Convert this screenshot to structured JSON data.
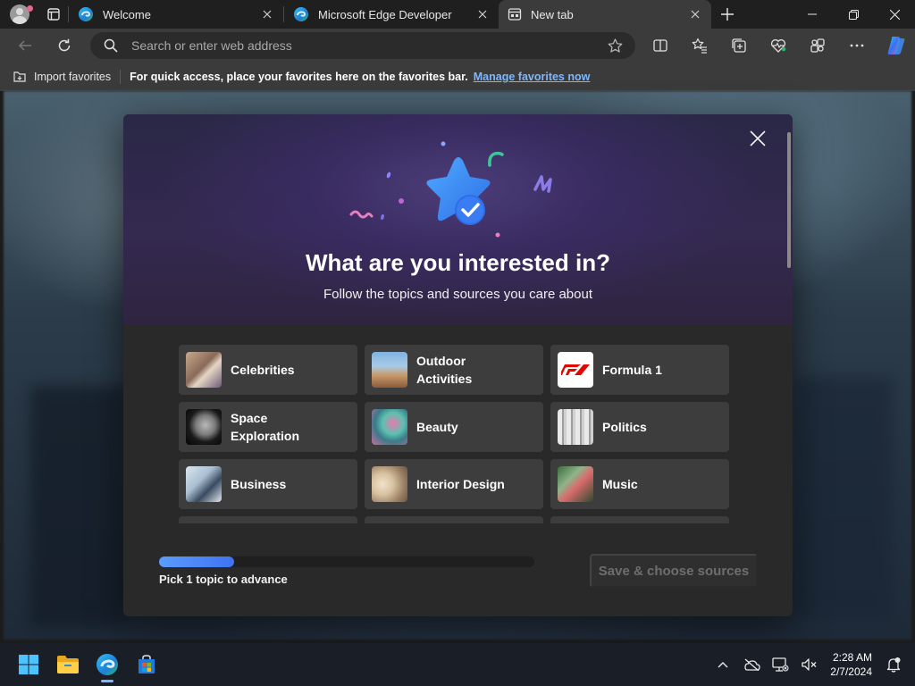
{
  "browser": {
    "tabs": [
      {
        "label": "Welcome",
        "active": false
      },
      {
        "label": "Microsoft Edge Developer",
        "active": false
      },
      {
        "label": "New tab",
        "active": true
      }
    ],
    "omnibox_placeholder": "Search or enter web address"
  },
  "favorites_bar": {
    "import_label": "Import favorites",
    "message": "For quick access, place your favorites here on the favorites bar.",
    "manage_link": "Manage favorites now"
  },
  "modal": {
    "title": "What are you interested in?",
    "subtitle": "Follow the topics and sources you care about",
    "topics": [
      {
        "label": "Celebrities"
      },
      {
        "label": "Outdoor Activities"
      },
      {
        "label": "Formula 1"
      },
      {
        "label": "Space Exploration"
      },
      {
        "label": "Beauty"
      },
      {
        "label": "Politics"
      },
      {
        "label": "Business"
      },
      {
        "label": "Interior Design"
      },
      {
        "label": "Music"
      }
    ],
    "progress": {
      "fraction": 0.2,
      "text": "Pick 1 topic to advance"
    },
    "save_label": "Save & choose sources"
  },
  "taskbar": {
    "time": "2:28 AM",
    "date": "2/7/2024"
  },
  "colors": {
    "accent": "#3f72f0",
    "link": "#7cb7ff",
    "tab_active_bg": "#3b3b3b"
  }
}
